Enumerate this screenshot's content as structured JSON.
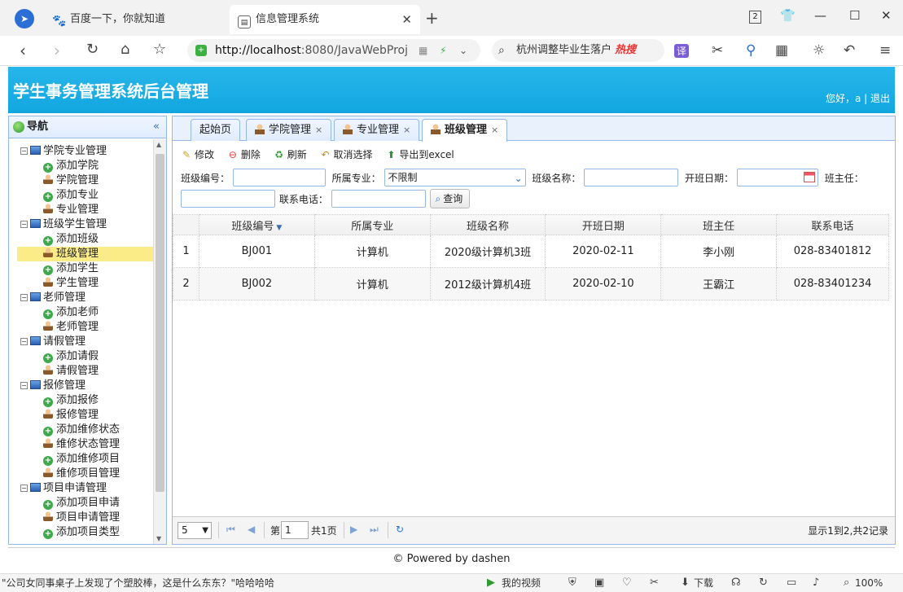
{
  "browser": {
    "tabs": [
      {
        "title": "百度一下，你就知道",
        "icon": "baidu-paw-icon"
      },
      {
        "title": "信息管理系统",
        "icon": "page-icon",
        "close": "✕"
      }
    ],
    "new_tab": "+",
    "tab_count": "2",
    "url_host": "http://localhost",
    "url_rest": ":8080/JavaWebProj",
    "search_text": "杭州调整毕业生落户",
    "search_hot": "热搜",
    "translate_label": "译",
    "win": {
      "minimize": "—",
      "maximize": "☐",
      "close": "✕"
    }
  },
  "app": {
    "title": "学生事务管理系统后台管理",
    "greeting": "您好，a | 退出"
  },
  "nav": {
    "title": "导航",
    "collapse": "«",
    "groups": [
      {
        "label": "学院专业管理",
        "items": [
          "添加学院",
          "学院管理",
          "添加专业",
          "专业管理"
        ]
      },
      {
        "label": "班级学生管理",
        "items": [
          "添加班级",
          "班级管理",
          "添加学生",
          "学生管理"
        ]
      },
      {
        "label": "老师管理",
        "items": [
          "添加老师",
          "老师管理"
        ]
      },
      {
        "label": "请假管理",
        "items": [
          "添加请假",
          "请假管理"
        ]
      },
      {
        "label": "报修管理",
        "items": [
          "添加报修",
          "报修管理",
          "添加维修状态",
          "维修状态管理",
          "添加维修项目",
          "维修项目管理"
        ]
      },
      {
        "label": "项目申请管理",
        "items": [
          "添加项目申请",
          "项目申请管理",
          "添加项目类型"
        ]
      }
    ],
    "selected": "班级管理"
  },
  "tabs": [
    {
      "label": "起始页"
    },
    {
      "label": "学院管理",
      "close": "×"
    },
    {
      "label": "专业管理",
      "close": "×"
    },
    {
      "label": "班级管理",
      "close": "×"
    }
  ],
  "toolbar": {
    "edit": "修改",
    "delete": "删除",
    "refresh": "刷新",
    "cancel": "取消选择",
    "export": "导出到excel"
  },
  "filters": {
    "class_no_label": "班级编号：",
    "major_label": "所属专业：",
    "major_value": "不限制",
    "class_name_label": "班级名称：",
    "start_date_label": "开班日期：",
    "teacher_label": "班主任：",
    "phone_label": "联系电话：",
    "query_button": "查询"
  },
  "grid": {
    "columns": [
      "班级编号",
      "所属专业",
      "班级名称",
      "开班日期",
      "班主任",
      "联系电话"
    ],
    "rows": [
      {
        "rownum": "1",
        "cells": [
          "BJ001",
          "计算机",
          "2020级计算机3班",
          "2020-02-11",
          "李小刚",
          "028-83401812"
        ]
      },
      {
        "rownum": "2",
        "cells": [
          "BJ002",
          "计算机",
          "2012级计算机4班",
          "2020-02-10",
          "王霸江",
          "028-83401234"
        ]
      }
    ]
  },
  "pager": {
    "page_size": "5",
    "page_label": "第",
    "page_value": "1",
    "total_pages": "共1页",
    "info": "显示1到2,共2记录"
  },
  "footer": "© Powered by dashen",
  "statusbar": {
    "news": "\"公司女同事桌子上发现了个塑胶棒，这是什么东东？\"哈哈哈哈",
    "video": "我的视频",
    "download": "下载",
    "zoom": "100%"
  }
}
